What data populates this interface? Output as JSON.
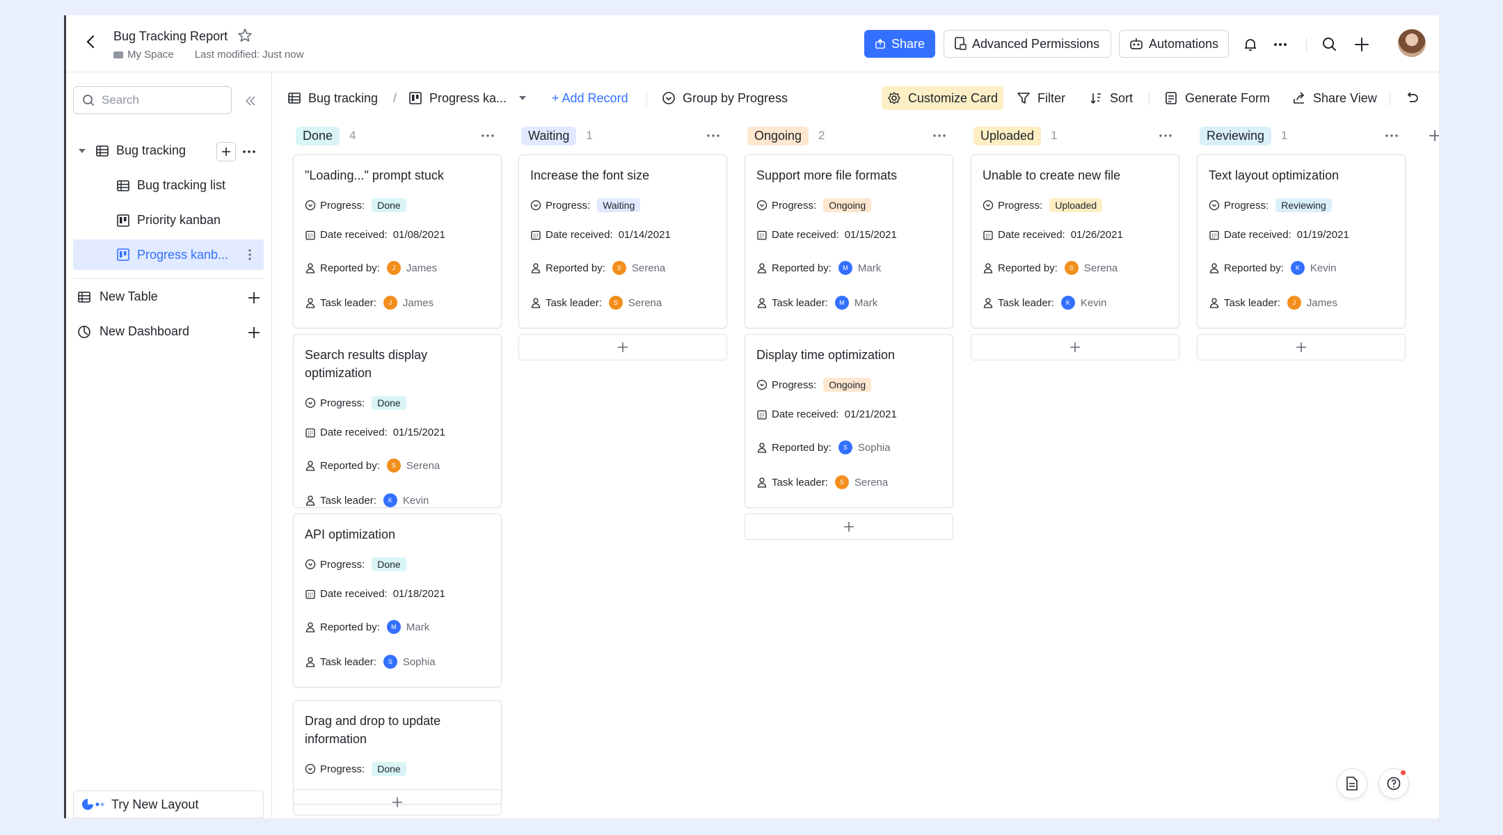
{
  "header": {
    "title": "Bug Tracking Report",
    "space": "My Space",
    "last_modified": "Last modified: Just now",
    "share": "Share",
    "advanced_permissions": "Advanced Permissions",
    "automations": "Automations"
  },
  "sidebar": {
    "search_placeholder": "Search",
    "base": "Bug tracking",
    "items": [
      {
        "label": "Bug tracking list"
      },
      {
        "label": "Priority kanban"
      },
      {
        "label": "Progress kanb..."
      }
    ],
    "new_table": "New Table",
    "new_dashboard": "New Dashboard",
    "try_new_layout": "Try New Layout"
  },
  "toolbar": {
    "table": "Bug tracking",
    "view": "Progress ka...",
    "add_record": "+ Add Record",
    "group_by": "Group by Progress",
    "customize_card": "Customize Card",
    "filter": "Filter",
    "sort": "Sort",
    "generate_form": "Generate Form",
    "share_view": "Share View"
  },
  "labels": {
    "progress": "Progress:",
    "date_received": "Date received:",
    "reported_by": "Reported by:",
    "task_leader": "Task leader:"
  },
  "columns": [
    {
      "name": "Done",
      "count": "4",
      "bg": "#d9f5f6",
      "cards": [
        {
          "title": "\"Loading...\" prompt stuck",
          "progress": "Done",
          "date": "01/08/2021",
          "reporter": "James",
          "reporter_initial": "J",
          "leader": "James",
          "leader_initial": "J"
        },
        {
          "title": "Search results display optimization",
          "progress": "Done",
          "date": "01/15/2021",
          "reporter": "Serena",
          "reporter_initial": "S",
          "leader": "Kevin",
          "leader_initial": "K"
        },
        {
          "title": "API optimization",
          "progress": "Done",
          "date": "01/18/2021",
          "reporter": "Mark",
          "reporter_initial": "M",
          "leader": "Sophia",
          "leader_initial": "S"
        },
        {
          "title": "Drag and drop to update information",
          "progress": "Done"
        }
      ]
    },
    {
      "name": "Waiting",
      "count": "1",
      "bg": "#e0e9ff",
      "cards": [
        {
          "title": "Increase the font size",
          "progress": "Waiting",
          "date": "01/14/2021",
          "reporter": "Serena",
          "reporter_initial": "S",
          "leader": "Serena",
          "leader_initial": "S"
        }
      ]
    },
    {
      "name": "Ongoing",
      "count": "2",
      "bg": "#fee6cf",
      "cards": [
        {
          "title": "Support more file formats",
          "progress": "Ongoing",
          "date": "01/15/2021",
          "reporter": "Mark",
          "reporter_initial": "M",
          "leader": "Mark",
          "leader_initial": "M"
        },
        {
          "title": "Display time optimization",
          "progress": "Ongoing",
          "date": "01/21/2021",
          "reporter": "Sophia",
          "reporter_initial": "S",
          "leader": "Serena",
          "leader_initial": "S"
        }
      ]
    },
    {
      "name": "Uploaded",
      "count": "1",
      "bg": "#fdeec3",
      "cards": [
        {
          "title": "Unable to create new file",
          "progress": "Uploaded",
          "date": "01/26/2021",
          "reporter": "Serena",
          "reporter_initial": "S",
          "leader": "Kevin",
          "leader_initial": "K"
        }
      ]
    },
    {
      "name": "Reviewing",
      "count": "1",
      "bg": "#d9f0f8",
      "cards": [
        {
          "title": "Text layout optimization",
          "progress": "Reviewing",
          "date": "01/19/2021",
          "reporter": "Kevin",
          "reporter_initial": "K",
          "leader": "James",
          "leader_initial": "J"
        }
      ]
    }
  ],
  "colors": {
    "accent": "#3370ff",
    "orange_avatar": "#f28e1c",
    "blue_avatar": "#3370ff"
  }
}
